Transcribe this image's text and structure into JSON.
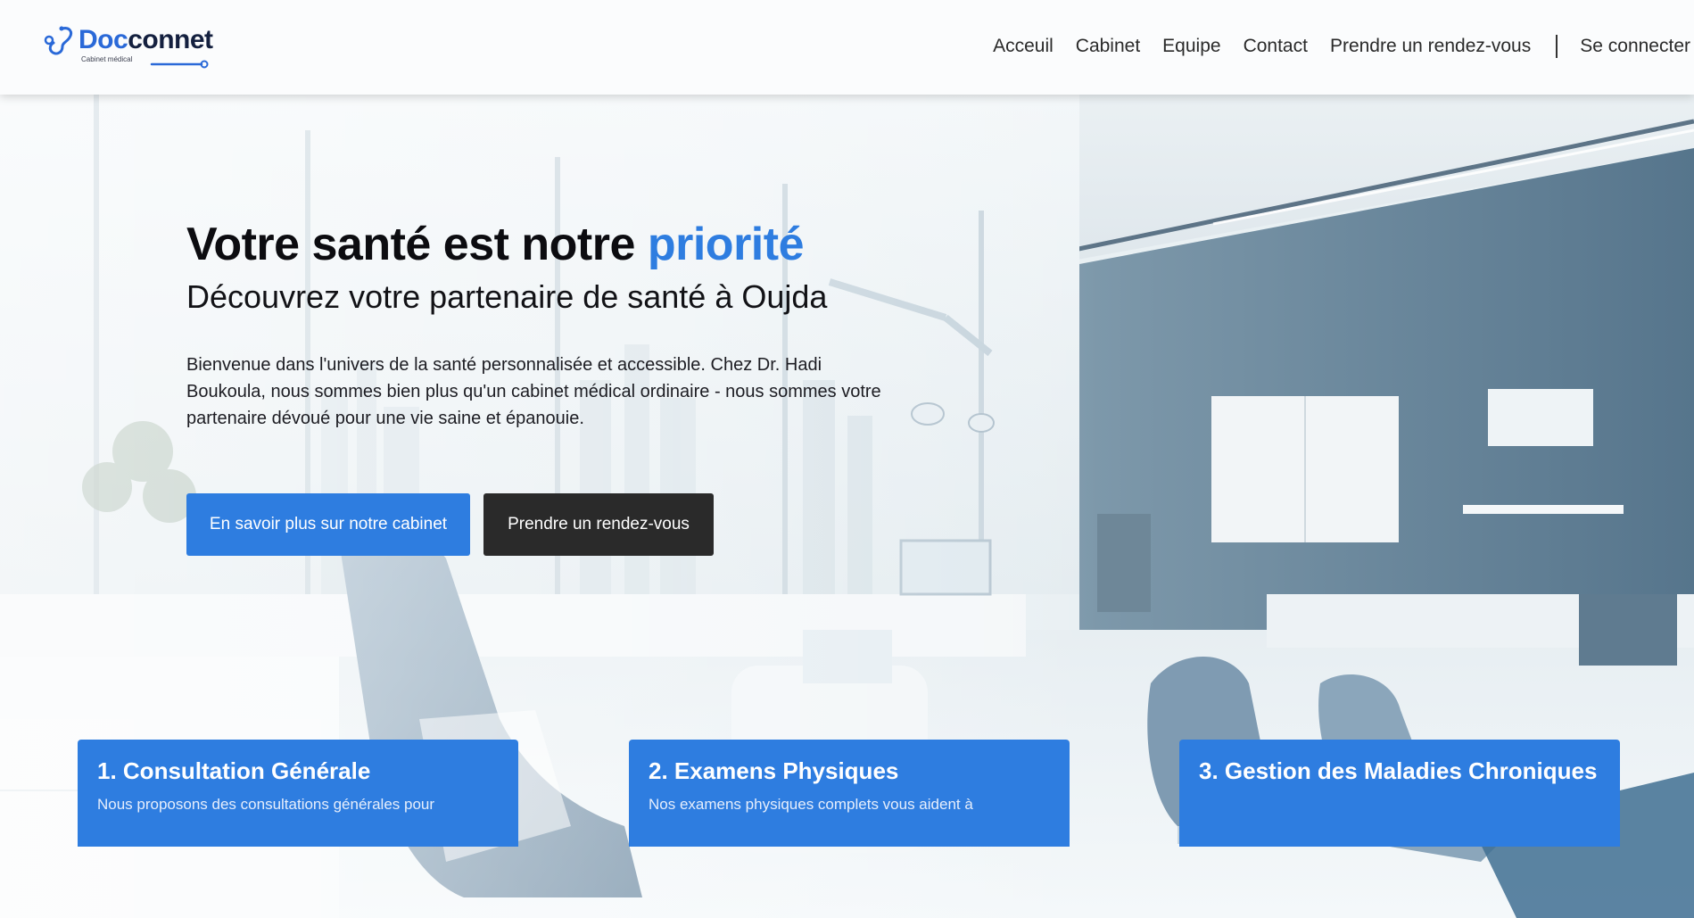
{
  "brand": {
    "name_part1": "Doc",
    "name_part2": "connet",
    "tagline": "Cabinet médical"
  },
  "nav": {
    "items": [
      "Acceuil",
      "Cabinet",
      "Equipe",
      "Contact",
      "Prendre un rendez-vous"
    ],
    "login": "Se connecter"
  },
  "hero": {
    "title_main": "Votre santé est notre",
    "title_accent": "priorité",
    "subtitle": "Découvrez votre partenaire de santé à Oujda",
    "description": "Bienvenue dans l'univers de la santé personnalisée et accessible. Chez Dr. Hadi Boukoula, nous sommes bien plus qu'un cabinet médical ordinaire - nous sommes votre partenaire dévoué pour une vie saine et épanouie.",
    "btn_primary": "En savoir plus sur notre cabinet",
    "btn_secondary": "Prendre un rendez-vous"
  },
  "services": [
    {
      "title": "1. Consultation Générale",
      "text": "Nous proposons des consultations générales pour"
    },
    {
      "title": "2. Examens Physiques",
      "text": "Nos examens physiques complets vous aident à"
    },
    {
      "title": "3. Gestion des Maladies Chroniques",
      "text": ""
    }
  ],
  "colors": {
    "accent": "#2e7de0",
    "dark_button": "#2a2a2a",
    "brand_navy": "#14203f"
  }
}
